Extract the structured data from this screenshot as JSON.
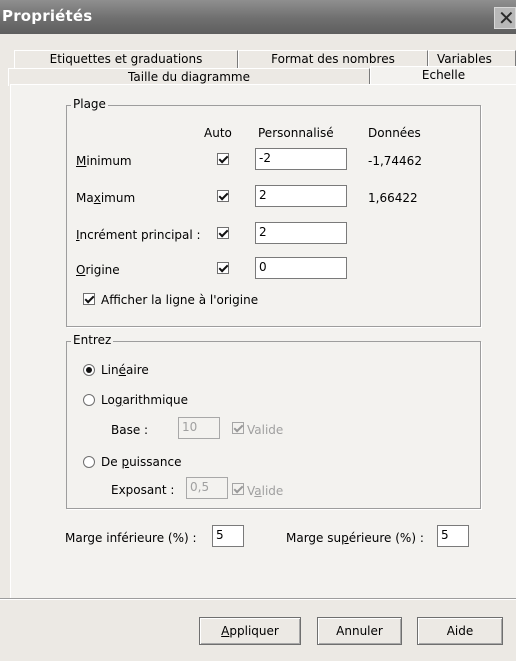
{
  "window": {
    "title": "Propriétés",
    "close_glyph": "✕"
  },
  "tabs": {
    "row1": [
      "Etiquettes et graduations",
      "Format des nombres",
      "Variables"
    ],
    "row2": [
      "Taille du diagramme",
      "Echelle"
    ]
  },
  "plage": {
    "legend": "Plage",
    "headers": {
      "auto": "Auto",
      "custom": "Personnalisé",
      "data": "Données"
    },
    "rows": [
      {
        "hot": "M",
        "rest": "inimum",
        "value": "-2",
        "data": "-1,74462"
      },
      {
        "pre": "Ma",
        "hot": "x",
        "rest": "imum",
        "value": "2",
        "data": "1,66422"
      },
      {
        "hot": "I",
        "rest": "ncrément principal :",
        "value": "2",
        "data": ""
      },
      {
        "hot": "O",
        "rest": "rigine",
        "value": "0",
        "data": ""
      }
    ],
    "show_origin_line": "Afficher la ligne à l'origine"
  },
  "entrez": {
    "legend": "Entrez",
    "lineaire": {
      "pre": "Lin",
      "hot": "é",
      "rest": "aire"
    },
    "log": {
      "pre": "Lo",
      "hot": "g",
      "rest": "arithmique"
    },
    "base_label": "Base :",
    "base_value": "10",
    "valide1": "Valide",
    "puissance": {
      "pre": "De ",
      "hot": "p",
      "rest": "uissance"
    },
    "exposant_label": "Exposant :",
    "exposant_value": "0,5",
    "valide2": {
      "pre": "V",
      "hot": "a",
      "rest": "lide"
    }
  },
  "margins": {
    "lower_label": "Marge inférieure (%) :",
    "lower_value": "5",
    "upper_pre": "Marge su",
    "upper_hot": "p",
    "upper_rest": "érieure (%) :",
    "upper_value": "5"
  },
  "buttons": {
    "apply": {
      "hot": "A",
      "rest": "ppliquer"
    },
    "cancel": "Annuler",
    "help": "Aide"
  }
}
